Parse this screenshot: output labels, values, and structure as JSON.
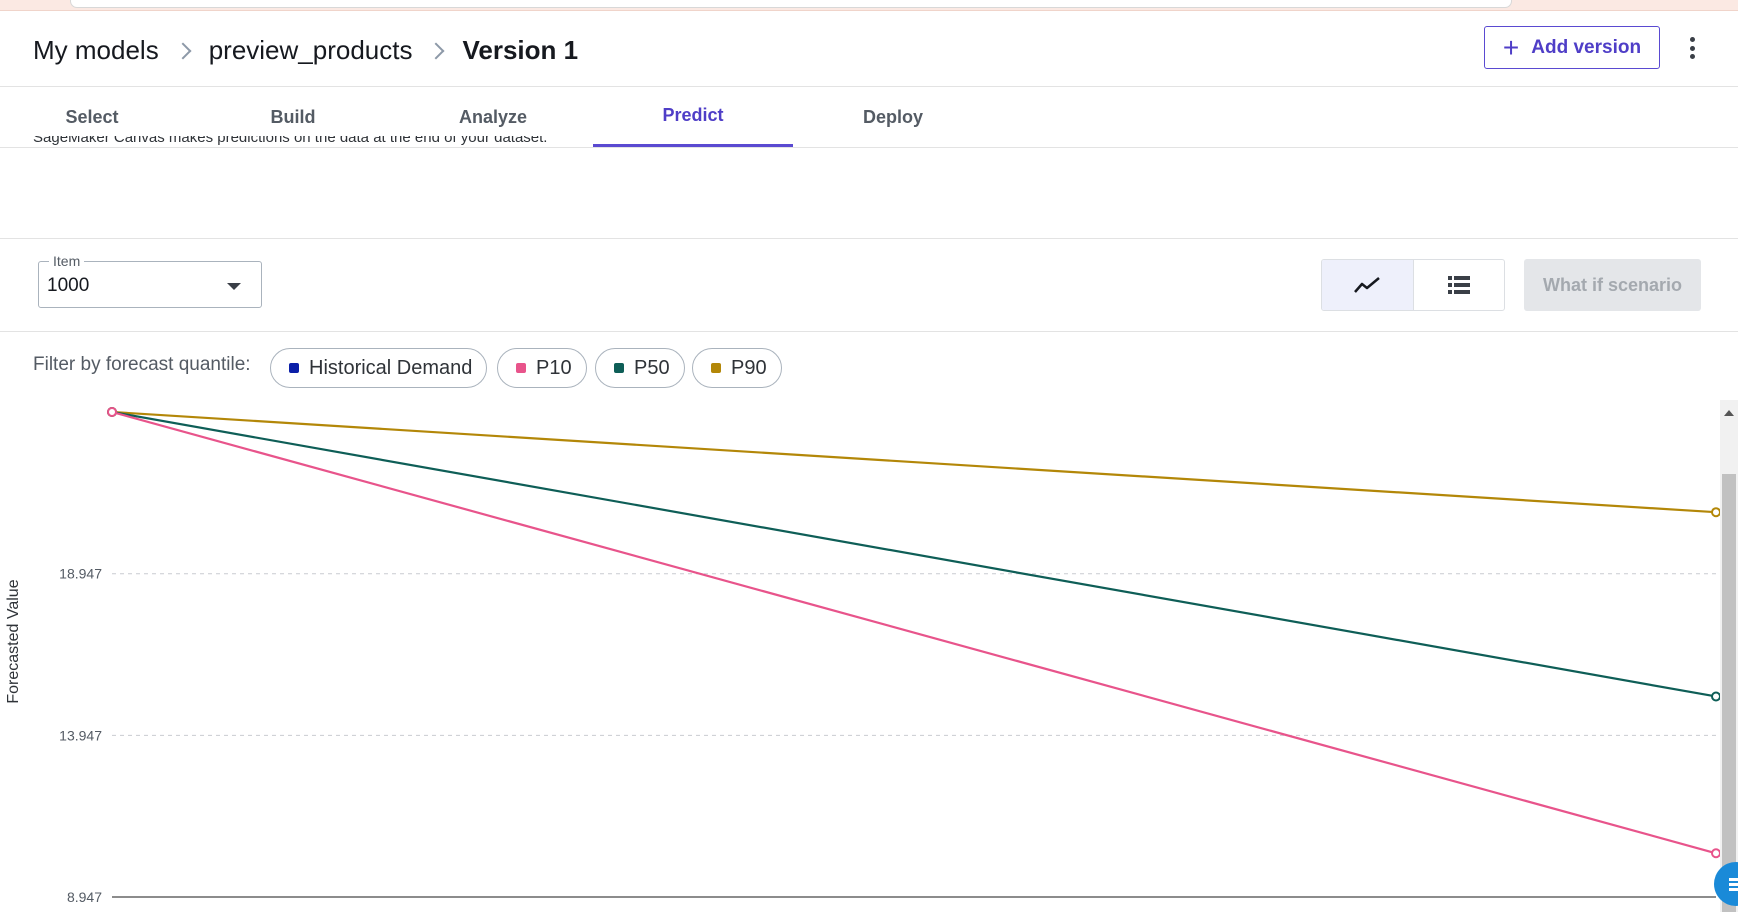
{
  "breadcrumb": {
    "root": "My models",
    "model": "preview_products",
    "current": "Version 1"
  },
  "header": {
    "add_version_label": "Add version",
    "more_icon": "kebab-menu-icon"
  },
  "tabs": [
    {
      "label": "Select",
      "active": false
    },
    {
      "label": "Build",
      "active": false
    },
    {
      "label": "Analyze",
      "active": false
    },
    {
      "label": "Predict",
      "active": true
    },
    {
      "label": "Deploy",
      "active": false
    }
  ],
  "description": "SageMaker Canvas makes predictions on the data at the end of your dataset.",
  "item_selector": {
    "label": "Item",
    "value": "1000"
  },
  "view_toggle": {
    "selected": "chart",
    "options": [
      "line-chart-icon",
      "table-list-icon"
    ]
  },
  "what_if_label": "What if scenario",
  "filter": {
    "label": "Filter by forecast quantile:",
    "chips": [
      {
        "label": "Historical Demand",
        "color": "#0b1fa8"
      },
      {
        "label": "P10",
        "color": "#e8548b"
      },
      {
        "label": "P50",
        "color": "#0e5e57"
      },
      {
        "label": "P90",
        "color": "#b38708"
      }
    ]
  },
  "chart_data": {
    "type": "line",
    "ylabel": "Forecasted Value",
    "yticks": [
      "18.947",
      "13.947",
      "8.947"
    ],
    "ylim": [
      8.947,
      23.95
    ],
    "grid": true,
    "series": [
      {
        "name": "P90",
        "color": "#b38708",
        "values": [
          23.95,
          20.85
        ]
      },
      {
        "name": "P50",
        "color": "#0e5e57",
        "values": [
          23.95,
          15.15
        ]
      },
      {
        "name": "P10",
        "color": "#e8548b",
        "values": [
          23.95,
          10.3
        ]
      }
    ]
  }
}
